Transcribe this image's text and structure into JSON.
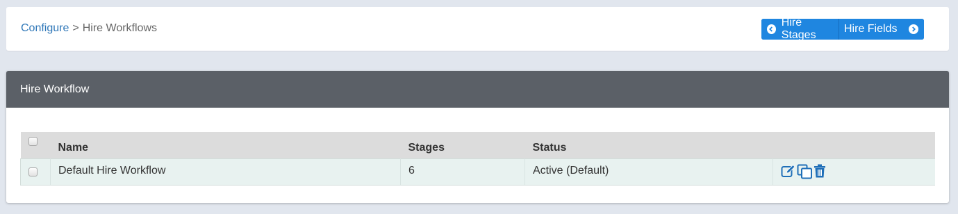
{
  "breadcrumb": {
    "parent": "Configure",
    "separator": ">",
    "current": "Hire Workflows"
  },
  "nav_buttons": {
    "prev_label": "Hire Stages",
    "next_label": "Hire Fields",
    "prev_icon": "chevron-left-circle-icon",
    "next_icon": "chevron-right-circle-icon"
  },
  "panel": {
    "title": "Hire Workflow"
  },
  "table": {
    "columns": [
      "Name",
      "Stages",
      "Status",
      ""
    ],
    "rows": [
      {
        "name": "Default Hire Workflow",
        "stages": "6",
        "status": "Active (Default)",
        "actions": [
          "edit-icon",
          "copy-icon",
          "delete-icon"
        ]
      }
    ]
  },
  "colors": {
    "accent": "#1f86e0",
    "link": "#2f77b8",
    "panel_header": "#5b6067",
    "row_bg": "#e8f2f0",
    "background": "#e1e6ee"
  }
}
